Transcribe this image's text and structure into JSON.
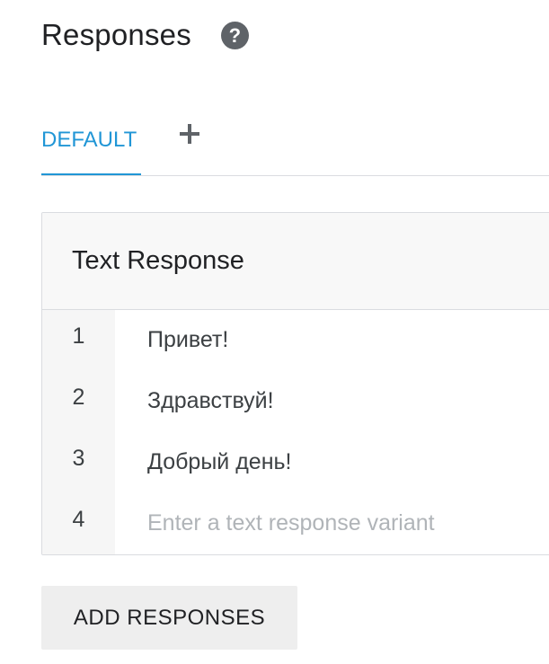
{
  "header": {
    "title": "Responses",
    "help_icon": "question-circle-icon"
  },
  "tabs": {
    "default_label": "DEFAULT",
    "add_icon": "plus-icon",
    "active_color": "#2196d6"
  },
  "card": {
    "title": "Text Response",
    "rows": [
      {
        "number": "1",
        "text": "Привет!"
      },
      {
        "number": "2",
        "text": "Здравствуй!"
      },
      {
        "number": "3",
        "text": "Добрый день!"
      }
    ],
    "new_row": {
      "number": "4",
      "placeholder": "Enter a text response variant"
    }
  },
  "actions": {
    "add_responses_label": "ADD RESPONSES"
  }
}
